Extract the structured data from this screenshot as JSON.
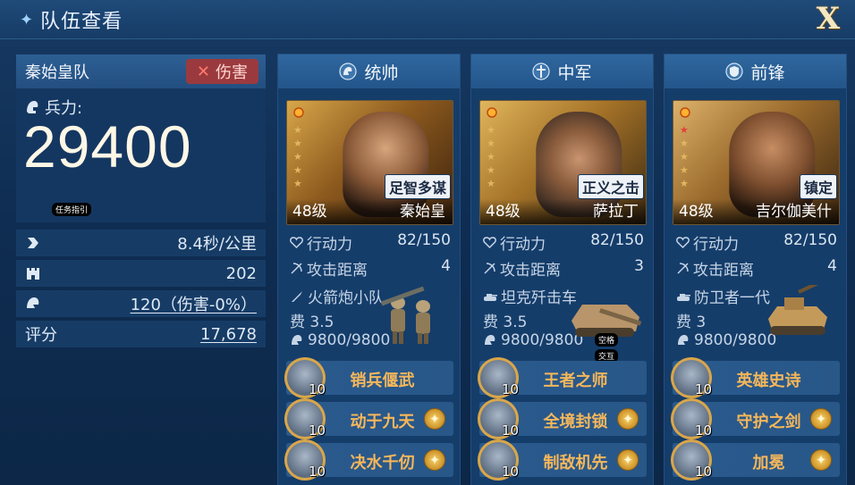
{
  "header": {
    "title": "队伍查看",
    "close_label": "X"
  },
  "team": {
    "name": "秦始皇队",
    "damage_label": "伤害",
    "troops_label": "兵力:",
    "troops_value": "29400",
    "tooltip": "任务指引",
    "stats": [
      {
        "icon": "speed-icon",
        "value": "8.4秒/公里"
      },
      {
        "icon": "castle-icon",
        "value": "202"
      },
      {
        "icon": "helmet-icon",
        "value": "120（伤害-0%）"
      }
    ],
    "score_label": "评分",
    "score_value": "17,678"
  },
  "cards": [
    {
      "role": "统帅",
      "level": "48级",
      "hero": "秦始皇",
      "trait": "足智多谋",
      "stars_red": 0,
      "action_label": "行动力",
      "action_value": "82/150",
      "range_label": "攻击距离",
      "range_value": "4",
      "unit_name": "火箭炮小队",
      "unit_cost": "费 3.5",
      "unit_hp": "9800/9800",
      "skills": [
        {
          "name": "销兵偃武",
          "level": "10",
          "star": false
        },
        {
          "name": "动于九天",
          "level": "10",
          "star": true
        },
        {
          "name": "决水千仞",
          "level": "10",
          "star": true
        }
      ]
    },
    {
      "role": "中军",
      "level": "48级",
      "hero": "萨拉丁",
      "trait": "正义之击",
      "stars_red": 0,
      "action_label": "行动力",
      "action_value": "82/150",
      "range_label": "攻击距离",
      "range_value": "3",
      "unit_name": "坦克歼击车",
      "unit_cost": "费 3.5",
      "unit_hp": "9800/9800",
      "tags": [
        "空格",
        "交互"
      ],
      "skills": [
        {
          "name": "王者之师",
          "level": "10",
          "star": false
        },
        {
          "name": "全境封锁",
          "level": "10",
          "star": true
        },
        {
          "name": "制敌机先",
          "level": "10",
          "star": true
        }
      ]
    },
    {
      "role": "前锋",
      "level": "48级",
      "hero": "吉尔伽美什",
      "trait": "镇定",
      "stars_red": 1,
      "action_label": "行动力",
      "action_value": "82/150",
      "range_label": "攻击距离",
      "range_value": "4",
      "unit_name": "防卫者一代",
      "unit_cost": "费 3",
      "unit_hp": "9800/9800",
      "skills": [
        {
          "name": "英雄史诗",
          "level": "10",
          "star": false
        },
        {
          "name": "守护之剑",
          "level": "10",
          "star": true
        },
        {
          "name": "加冕",
          "level": "10",
          "star": true
        }
      ]
    }
  ],
  "colors": {
    "accent": "#f6b75a",
    "bg": "#0f2d52",
    "damage": "#9b3a3e"
  }
}
